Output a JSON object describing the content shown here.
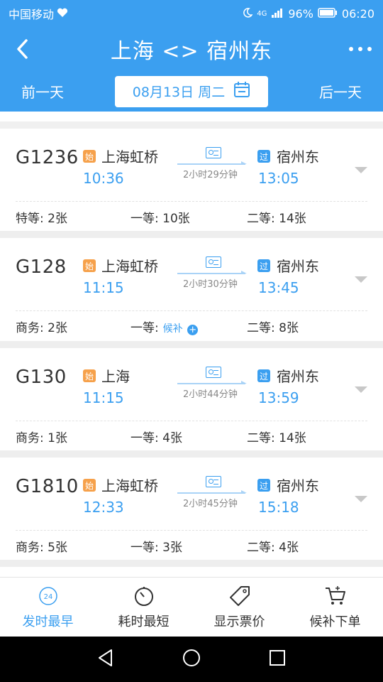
{
  "status_bar": {
    "carrier": "中国移动",
    "network": "4G",
    "battery": "96%",
    "time": "06:20"
  },
  "header": {
    "title": "上海 <> 宿州东",
    "back_icon": "back-arrow-icon",
    "more_icon": "more-dots-icon"
  },
  "date_bar": {
    "prev_label": "前一天",
    "date": "08月13日 周二",
    "next_label": "后一天"
  },
  "trains": [
    {
      "number": "G1236",
      "from_badge": "始",
      "from": "上海虹桥",
      "depart": "10:36",
      "duration": "2小时29分钟",
      "to_badge": "过",
      "to": "宿州东",
      "arrive": "13:05",
      "seats": [
        {
          "label": "特等: 2张"
        },
        {
          "label": "一等: 10张"
        },
        {
          "label": "二等: 14张"
        }
      ]
    },
    {
      "number": "G128",
      "from_badge": "始",
      "from": "上海虹桥",
      "depart": "11:15",
      "duration": "2小时30分钟",
      "to_badge": "过",
      "to": "宿州东",
      "arrive": "13:45",
      "seats": [
        {
          "label": "商务: 2张"
        },
        {
          "label": "一等:",
          "waitlist": "候补"
        },
        {
          "label": "二等: 8张"
        }
      ]
    },
    {
      "number": "G130",
      "from_badge": "始",
      "from": "上海",
      "depart": "11:15",
      "duration": "2小时44分钟",
      "to_badge": "过",
      "to": "宿州东",
      "arrive": "13:59",
      "seats": [
        {
          "label": "商务: 1张"
        },
        {
          "label": "一等: 4张"
        },
        {
          "label": "二等: 14张"
        }
      ]
    },
    {
      "number": "G1810",
      "from_badge": "始",
      "from": "上海虹桥",
      "depart": "12:33",
      "duration": "2小时45分钟",
      "to_badge": "过",
      "to": "宿州东",
      "arrive": "15:18",
      "seats": [
        {
          "label": "商务: 5张"
        },
        {
          "label": "一等: 3张"
        },
        {
          "label": "二等: 4张"
        }
      ]
    }
  ],
  "tab_bar": {
    "tabs": [
      {
        "label": "发时最早",
        "icon": "clock-24-icon",
        "active": true
      },
      {
        "label": "耗时最短",
        "icon": "timer-icon",
        "active": false
      },
      {
        "label": "显示票价",
        "icon": "price-tag-icon",
        "active": false
      },
      {
        "label": "候补下单",
        "icon": "cart-plus-icon",
        "active": false
      }
    ]
  },
  "colors": {
    "primary": "#3b9ff0",
    "start_badge": "#f6a14b"
  }
}
